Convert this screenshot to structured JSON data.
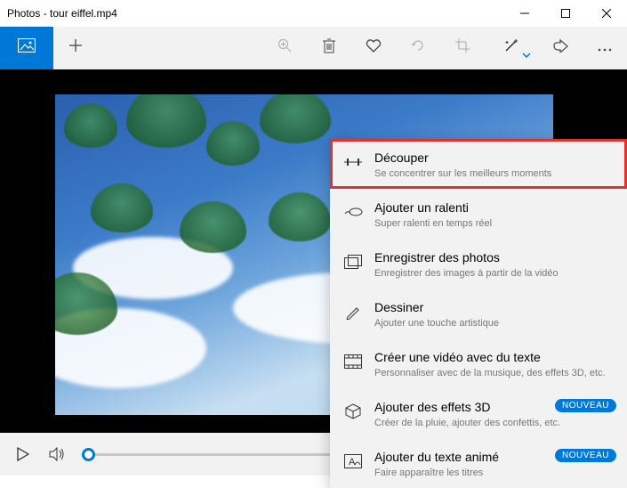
{
  "titlebar": {
    "title": "Photos - tour eiffel.mp4"
  },
  "menu": {
    "items": [
      {
        "title": "Découper",
        "sub": "Se concentrer sur les meilleurs moments"
      },
      {
        "title": "Ajouter un ralenti",
        "sub": "Super ralenti en temps réel"
      },
      {
        "title": "Enregistrer des photos",
        "sub": "Enregistrer des images à partir de la vidéo"
      },
      {
        "title": "Dessiner",
        "sub": "Ajouter une touche artistique"
      },
      {
        "title": "Créer une vidéo avec du texte",
        "sub": "Personnaliser avec de la musique, des effets 3D, etc."
      },
      {
        "title": "Ajouter des effets 3D",
        "sub": "Créer de la pluie, ajouter des confettis, etc.",
        "badge": "NOUVEAU"
      },
      {
        "title": "Ajouter du texte animé",
        "sub": "Faire apparaître les titres",
        "badge": "NOUVEAU"
      }
    ]
  }
}
